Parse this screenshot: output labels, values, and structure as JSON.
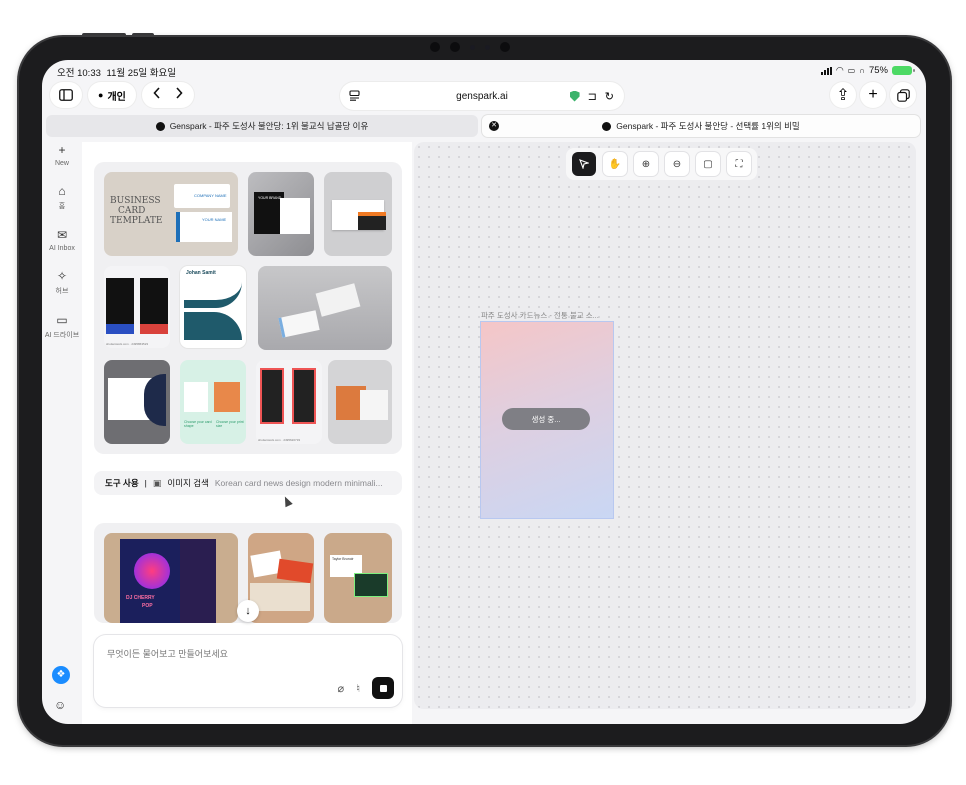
{
  "status_bar": {
    "time": "오전 10:33",
    "date": "11월 25일 화요일",
    "battery": "75%"
  },
  "toolbar": {
    "profile_label": "개인",
    "url": "genspark.ai"
  },
  "tabs": [
    {
      "title": "Genspark - 파주 도성사 불안당: 1위 불교식 납골당 이유"
    },
    {
      "title": "Genspark - 파주 도성사 불안당 - 선택률 1위의 비밀"
    }
  ],
  "sidebar": {
    "items": [
      {
        "label": "New",
        "icon": "plus-icon"
      },
      {
        "label": "홈",
        "icon": "home-icon"
      },
      {
        "label": "AI Inbox",
        "icon": "inbox-icon"
      },
      {
        "label": "허브",
        "icon": "hub-icon"
      },
      {
        "label": "AI 드라이브",
        "icon": "folder-icon"
      }
    ]
  },
  "chat": {
    "tool_use_label": "도구 사용",
    "tool_separator": "|",
    "tool_name": "이미지 검색",
    "tool_query": "Korean card news design modern minimali...",
    "input_placeholder": "무엇이든 물어보고 만들어보세요"
  },
  "thumbnails": {
    "t1_line1": "BUSINESS",
    "t1_line2": "CARD",
    "t1_line3": "TEMPLATE",
    "t1_company": "COMPANY NAME",
    "t1_your_name": "YOUR NAME",
    "t2_company": "YOUR BRAND",
    "t4_name": "Johan Samit",
    "t5_credit": "shutterstock.com · 2495863523",
    "t9_credit": "shutterstock.com · 2495620733",
    "t8_caption": "Choose your card shape",
    "t8_caption2": "Choose your print size",
    "t11_dj": "DJ CHERRY",
    "t11_pop": "POP",
    "t13_name": "Taylor Brunoir"
  },
  "canvas": {
    "frame_title": "파주 도성사 카드뉴스 - 전통 불교 스...",
    "generating_label": "생성 중..."
  },
  "icons": {
    "sidebar_toggle": "sidebar-toggle-icon",
    "person": "person-icon",
    "back": "chevron-left-icon",
    "forward": "chevron-right-icon",
    "reader": "reader-icon",
    "shield": "shield-icon",
    "extension": "extension-icon",
    "reload": "reload-icon",
    "share": "share-icon",
    "new_tab": "plus-icon",
    "tabs_overview": "tabs-icon"
  },
  "colors": {
    "accent_blue": "#1a8cff",
    "shield_green": "#3bb36b",
    "battery_green": "#4cd964",
    "frame_gradient_top": "#f5c6c7",
    "frame_gradient_bottom": "#c9d7f4"
  }
}
